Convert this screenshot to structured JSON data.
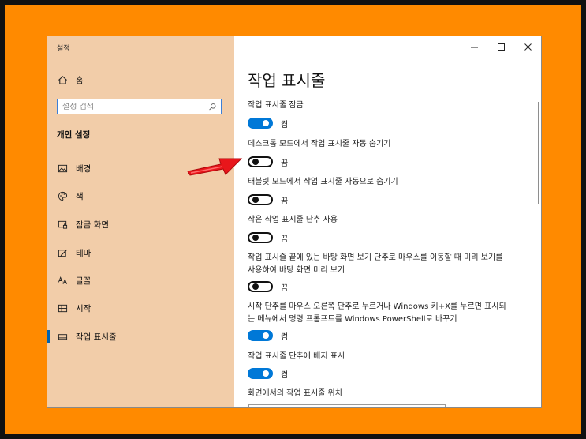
{
  "window": {
    "title": "설정"
  },
  "sidebar": {
    "home_label": "홈",
    "search_placeholder": "설정 검색",
    "section_title": "개인 설정",
    "items": [
      {
        "label": "배경",
        "icon": "image-icon"
      },
      {
        "label": "색",
        "icon": "palette-icon"
      },
      {
        "label": "잠금 화면",
        "icon": "lock-screen-icon"
      },
      {
        "label": "테마",
        "icon": "theme-icon"
      },
      {
        "label": "글꼴",
        "icon": "font-icon"
      },
      {
        "label": "시작",
        "icon": "start-icon"
      },
      {
        "label": "작업 표시줄",
        "icon": "taskbar-icon",
        "selected": true
      }
    ]
  },
  "main": {
    "title": "작업 표시줄",
    "settings": [
      {
        "label": "작업 표시줄 잠금",
        "state": "켬",
        "on": true
      },
      {
        "label": "데스크톱 모드에서 작업 표시줄 자동 숨기기",
        "state": "끔",
        "on": false
      },
      {
        "label": "태블릿 모드에서 작업 표시줄 자동으로 숨기기",
        "state": "끔",
        "on": false
      },
      {
        "label": "작은 작업 표시줄 단추 사용",
        "state": "끔",
        "on": false
      },
      {
        "label": "작업 표시줄 끝에 있는 바탕 화면 보기 단추로 마우스를 이동할 때 미리 보기를 사용하여 바탕 화면 미리 보기",
        "state": "끔",
        "on": false
      },
      {
        "label": "시작 단추를 마우스 오른쪽 단추로 누르거나 Windows 키+X를 누르면 표시되는 메뉴에서 명령 프롬프트를 Windows PowerShell로 바꾸기",
        "state": "켬",
        "on": true
      },
      {
        "label": "작업 표시줄 단추에 배지 표시",
        "state": "켬",
        "on": true
      }
    ],
    "position_label": "화면에서의 작업 표시줄 위치"
  },
  "colors": {
    "sidebar_bg": "#f2cda9",
    "accent": "#0078d7",
    "frame": "#ff8a00",
    "arrow": "#e8161b"
  }
}
